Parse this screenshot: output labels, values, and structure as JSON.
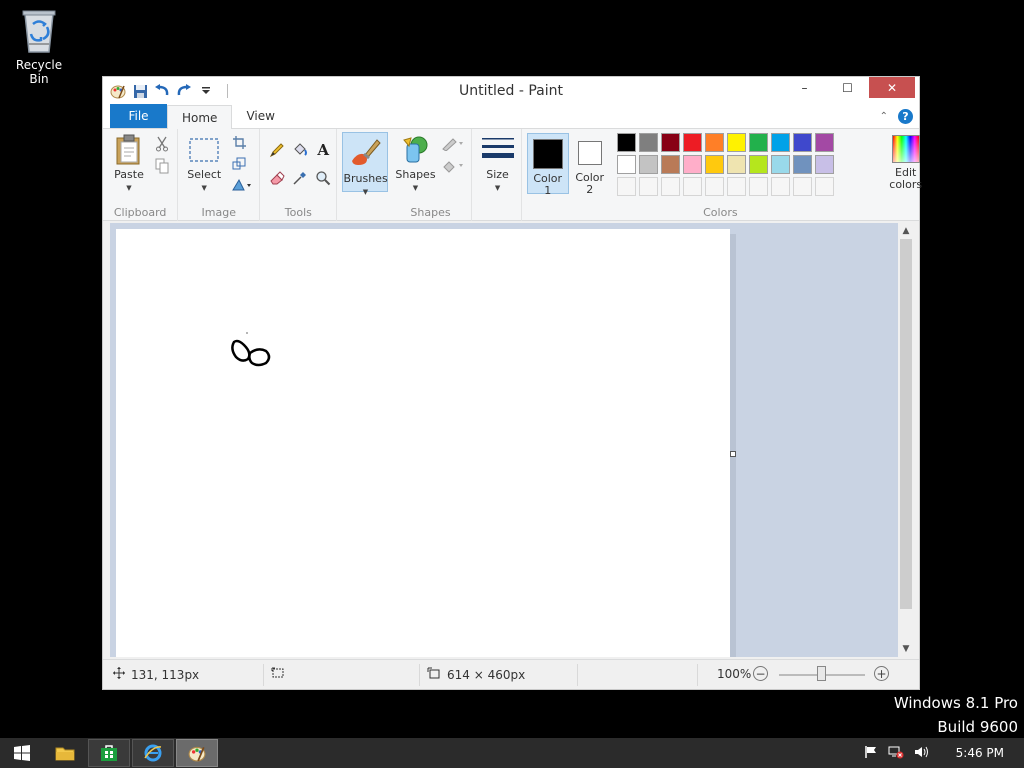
{
  "desktop": {
    "recycle_bin_label": "Recycle Bin",
    "watermark_line1": "Windows 8.1 Pro",
    "watermark_line2": "Build 9600"
  },
  "window": {
    "title": "Untitled - Paint",
    "controls": {
      "minimize": "–",
      "maximize": "☐",
      "close": "✕"
    }
  },
  "ribbon": {
    "tabs": [
      {
        "label": "File"
      },
      {
        "label": "Home"
      },
      {
        "label": "View"
      }
    ],
    "help": "?",
    "groups": {
      "clipboard": {
        "label": "Clipboard",
        "paste": "Paste"
      },
      "image": {
        "label": "Image",
        "select": "Select"
      },
      "tools": {
        "label": "Tools"
      },
      "brushes": {
        "label": "Brushes"
      },
      "shapes": {
        "label": "Shapes",
        "shapes_button": "Shapes"
      },
      "size": {
        "label": "Size"
      },
      "colors": {
        "label": "Colors",
        "color1": "Color",
        "color1_num": "1",
        "color2": "Color",
        "color2_num": "2",
        "edit_colors_line1": "Edit",
        "edit_colors_line2": "colors",
        "color1_value": "#000000",
        "color2_value": "#ffffff",
        "palette_row1": [
          "#000000",
          "#7f7f7f",
          "#880015",
          "#ed1c24",
          "#ff7f27",
          "#fff200",
          "#22b14c",
          "#00a2e8",
          "#3f48cc",
          "#a349a4"
        ],
        "palette_row2": [
          "#ffffff",
          "#c3c3c3",
          "#b97a57",
          "#ffaec9",
          "#ffc90e",
          "#efe4b0",
          "#b5e61d",
          "#99d9ea",
          "#7092be",
          "#c8bfe7"
        ]
      }
    }
  },
  "statusbar": {
    "cursor_pos": "131, 113px",
    "selection_size": "",
    "image_size": "614 × 460px",
    "zoom": "100%"
  },
  "taskbar": {
    "clock": "5:46 PM"
  }
}
